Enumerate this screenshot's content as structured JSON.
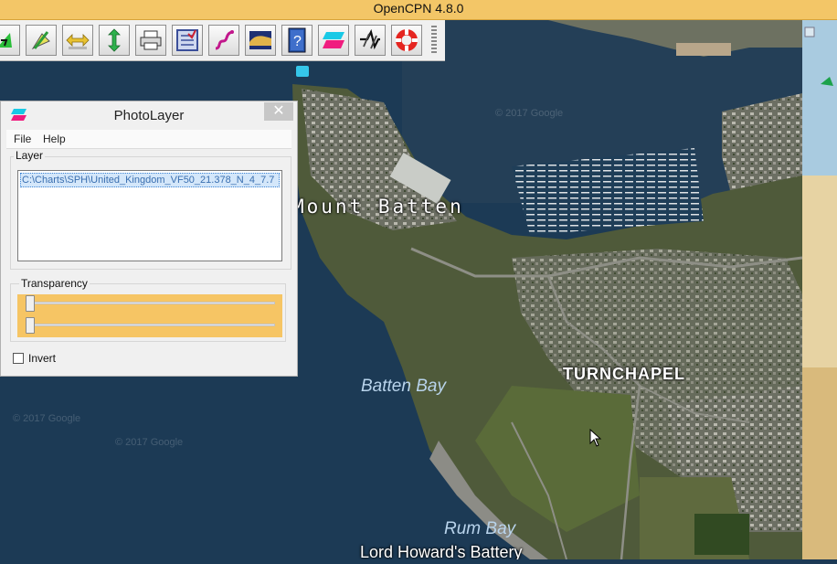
{
  "window": {
    "title": "OpenCPN 4.8.0"
  },
  "toolbar": {
    "buttons": [
      {
        "name": "zoom-in-button",
        "icon": "zoom-icon"
      },
      {
        "name": "route-create-button",
        "icon": "route-icon"
      },
      {
        "name": "auto-follow-horizontal-button",
        "icon": "horizontal-arrows-icon"
      },
      {
        "name": "auto-follow-vertical-button",
        "icon": "vertical-arrows-icon"
      },
      {
        "name": "print-button",
        "icon": "printer-icon"
      },
      {
        "name": "route-manager-button",
        "icon": "checklist-icon"
      },
      {
        "name": "track-button",
        "icon": "track-icon"
      },
      {
        "name": "tides-button",
        "icon": "tide-icon"
      },
      {
        "name": "help-button",
        "icon": "help-book-icon"
      },
      {
        "name": "photolayer-button",
        "icon": "photolayer-icon"
      },
      {
        "name": "weather-fax-button",
        "icon": "wavy-lines-icon"
      },
      {
        "name": "mob-button",
        "icon": "lifebuoy-icon"
      }
    ]
  },
  "dialog": {
    "title": "PhotoLayer",
    "close_glyph": "✕",
    "menu": {
      "file": "File",
      "help": "Help"
    },
    "layer_group_label": "Layer",
    "layer_items": [
      "C:\\Charts\\SPH\\United_Kingdom_VF50_21.378_N_4_7.7"
    ],
    "transparency_label": "Transparency",
    "sliders": [
      {
        "value": 0
      },
      {
        "value": 0
      }
    ],
    "invert_label": "Invert",
    "invert_checked": false
  },
  "map": {
    "labels": {
      "mount_batten": "Mount Batten",
      "turnchapel": "TURNCHAPEL",
      "batten_bay": "Batten Bay",
      "rum_bay": "Rum Bay",
      "lord_howards": "Lord Howard's Battery",
      "copyright_1": "© 2017 Google",
      "copyright_2": "© 2017 Google",
      "copyright_3": "© 2017 Google"
    }
  },
  "colors": {
    "titlebar": "#f3c667",
    "accent_slider": "#f6c564",
    "water": "#1c3a55",
    "land": "#4f5a3a"
  }
}
